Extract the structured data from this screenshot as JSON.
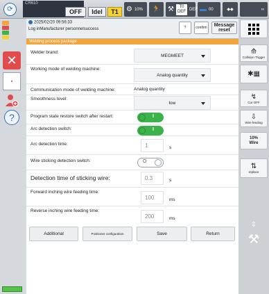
{
  "top": {
    "robot_name": "CR610",
    "off_label": "OFF",
    "idle_label": "Idel",
    "tool_label": "T1",
    "speed_label": "10%",
    "coord_label": "T0",
    "coord_sub": "DEF",
    "user_label": "DEF",
    "counter_label": "00",
    "inf_label": "∞"
  },
  "log": {
    "time": "2025/02/20 09:56:33",
    "message": "Log inManufacturer personnelsuccess",
    "help_label": "?",
    "confirm_label": "confirm",
    "reset_label": "Message reset"
  },
  "panel": {
    "title": "Welding process package",
    "welder_brand_label": "Welder brand:",
    "welder_brand_value": "MEGMEET",
    "working_mode_label": "Working mode of welding machine:",
    "working_mode_value": "Analog quantity",
    "comm_mode_label": "Communication mode of welding machine:",
    "comm_mode_value": "Analog quantity",
    "smoothness_label": "Smoothness level:",
    "smoothness_value": "low",
    "restore_label": "Program state restore switch after restart:",
    "arc_detect_label": "Arc detection switch:",
    "arc_time_label": "Arc detection time:",
    "arc_time_value": "1",
    "stick_switch_label": "Wire sticking detection switch:",
    "stick_time_label": "Detection time of sticking wire:",
    "stick_time_value": "0.3",
    "forward_label": "Forward inching wire feeding time:",
    "forward_value": "100",
    "reverse_label": "Reverse inching wire feeding time:",
    "reverse_value": "200",
    "unit_s": "s",
    "unit_ms": "ms",
    "toggle_on_mark": "I",
    "toggle_off_mark": "O"
  },
  "buttons": {
    "additional": "Additional",
    "positioner": "Positioner configuration",
    "save": "Save",
    "return": "Return"
  },
  "right": {
    "collision": "Collision Trigger",
    "cur_off": "Cur OFF",
    "wire_feeding": "Wire feeding",
    "wire_pct": "10%",
    "wire_label": "Wire",
    "replace": "replace"
  },
  "colors": {
    "accent": "#f3a53a",
    "toggle_on": "#3bb34a",
    "tool_yellow": "#f4d33a",
    "danger": "#e24b4b"
  }
}
